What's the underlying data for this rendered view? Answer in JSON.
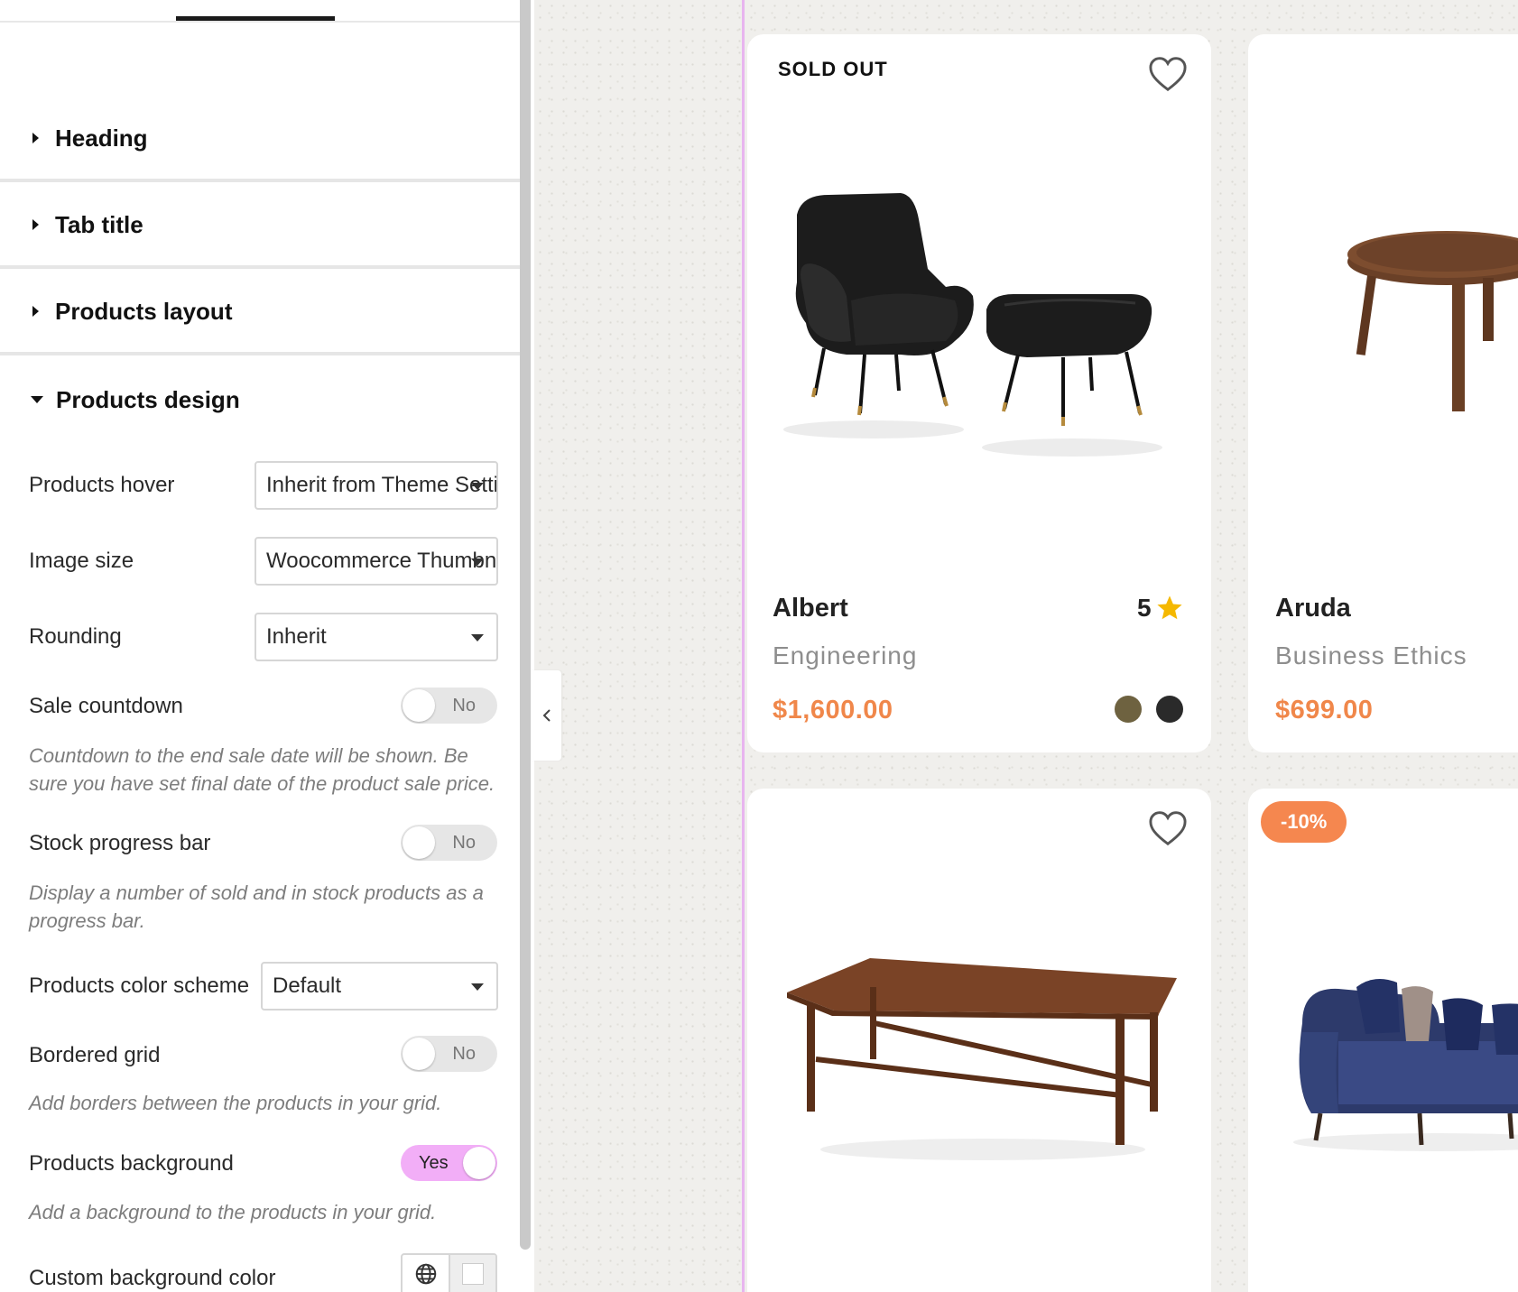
{
  "panel": {
    "sections": {
      "heading": "Heading",
      "tab_title": "Tab title",
      "products_layout": "Products layout",
      "products_design": "Products design"
    },
    "fields": {
      "products_hover": {
        "label": "Products hover",
        "value": "Inherit from Theme Settings"
      },
      "image_size": {
        "label": "Image size",
        "value": "Woocommerce Thumbnail"
      },
      "rounding": {
        "label": "Rounding",
        "value": "Inherit"
      },
      "sale_countdown": {
        "label": "Sale countdown",
        "toggle": "No",
        "help": "Countdown to the end sale date will be shown. Be sure you have set final date of the product sale price."
      },
      "stock_progress_bar": {
        "label": "Stock progress bar",
        "toggle": "No",
        "help": "Display a number of sold and in stock products as a progress bar."
      },
      "products_color_scheme": {
        "label": "Products color scheme",
        "value": "Default"
      },
      "bordered_grid": {
        "label": "Bordered grid",
        "toggle": "No",
        "help": "Add borders between the products in your grid."
      },
      "products_background": {
        "label": "Products background",
        "toggle": "Yes",
        "help": "Add a background to the products in your grid."
      },
      "custom_background_color": {
        "label": "Custom background color"
      }
    }
  },
  "products": [
    {
      "badge": "SOLD OUT",
      "name": "Albert",
      "category": "Engineering",
      "price": "$1,600.00",
      "rating": "5",
      "swatches": [
        "#6e6240",
        "#2a2a2a"
      ]
    },
    {
      "name": "Aruda",
      "category": "Business Ethics",
      "price": "$699.00"
    },
    {},
    {
      "sale": "-10%"
    }
  ],
  "colors": {
    "accent_price": "#f0874a",
    "sale_badge": "#f5874f",
    "toggle_on": "#f2aef7",
    "star": "#f5b800"
  }
}
